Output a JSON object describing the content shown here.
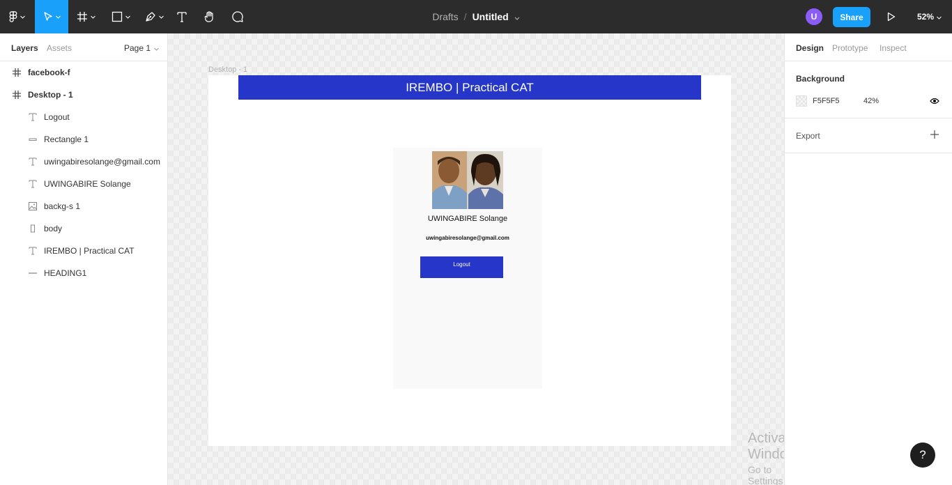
{
  "toolbar": {
    "project": "Drafts",
    "separator": "/",
    "file_name": "Untitled",
    "avatar_initial": "U",
    "share_label": "Share",
    "zoom": "52%",
    "accent_color": "#18a0fb"
  },
  "left_panel": {
    "tabs": [
      "Layers",
      "Assets"
    ],
    "page_selector": "Page 1",
    "layers": [
      {
        "label": "facebook-f",
        "icon": "frame-icon"
      },
      {
        "label": "Desktop - 1",
        "icon": "frame-icon"
      },
      {
        "label": "Logout",
        "icon": "text-icon"
      },
      {
        "label": "Rectangle 1",
        "icon": "rectangle-icon"
      },
      {
        "label": "uwingabiresolange@gmail.com",
        "icon": "text-icon"
      },
      {
        "label": "UWINGABIRE Solange",
        "icon": "text-icon"
      },
      {
        "label": "backg-s 1",
        "icon": "image-icon"
      },
      {
        "label": "body",
        "icon": "rectangle-icon"
      },
      {
        "label": "IREMBO | Practical CAT",
        "icon": "text-icon"
      },
      {
        "label": "HEADING1",
        "icon": "line-icon"
      }
    ]
  },
  "canvas": {
    "frame_label": "Desktop - 1",
    "heading": "IREMBO | Practical CAT",
    "heading_color": "#2536c9",
    "user_name": "UWINGABIRE  Solange",
    "email": "uwingabiresolange@gmail.com",
    "logout_label": "Logout"
  },
  "right_panel": {
    "tabs": [
      "Design",
      "Prototype",
      "Inspect"
    ],
    "background_title": "Background",
    "background_hex": "F5F5F5",
    "background_opacity": "42%",
    "export_title": "Export"
  },
  "watermark": {
    "line1": "Activate Windows",
    "line2": "Go to Settings to activate Windows."
  },
  "help_label": "?"
}
